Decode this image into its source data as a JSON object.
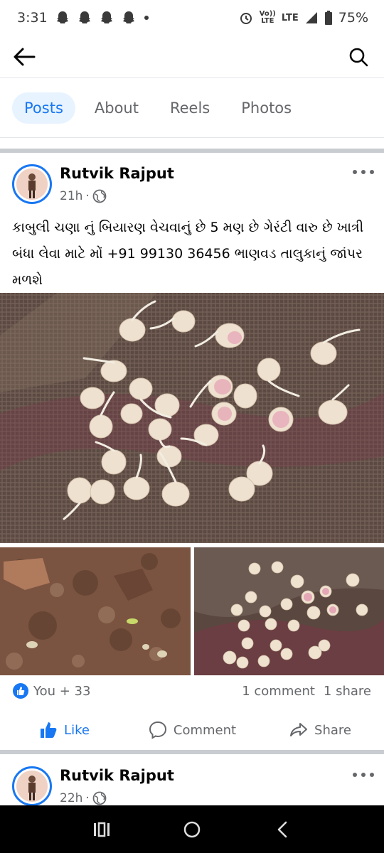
{
  "status_bar": {
    "time": "3:31",
    "network_top": "Vo))",
    "network_bottom": "LTE",
    "lte": "LTE",
    "battery": "75%"
  },
  "tabs": [
    {
      "label": "Posts",
      "active": true
    },
    {
      "label": "About",
      "active": false
    },
    {
      "label": "Reels",
      "active": false
    },
    {
      "label": "Photos",
      "active": false
    }
  ],
  "posts": [
    {
      "author": "Rutvik Rajput",
      "time": "21h",
      "privacy_icon": "globe-icon",
      "text": "કાબુલી ચણા નું બિયારણ વેચવાનું છે 5 મણ છે ગેરંટી વારુ છે ખાત્રી બંધા લેવા માટે મોં +91 99130 36456 ભાણવડ તાલુકાનું જાંપર મળશે",
      "reactions_label": "You + 33",
      "comments_label": "1 comment",
      "shares_label": "1 share"
    },
    {
      "author": "Rutvik Rajput",
      "time": "22h",
      "privacy_icon": "globe-icon"
    }
  ],
  "actions": {
    "like": "Like",
    "comment": "Comment",
    "share": "Share"
  },
  "icons": {
    "back": "arrow-left-icon",
    "search": "search-icon",
    "more": "more-horizontal-icon",
    "nav_recents": "recent-apps-icon",
    "nav_home": "home-circle-icon",
    "nav_back": "back-chevron-icon"
  },
  "colors": {
    "accent": "#1877f2",
    "active_tab_bg": "#e7f3ff",
    "muted_text": "#65676b",
    "divider": "#c9ccd1"
  }
}
